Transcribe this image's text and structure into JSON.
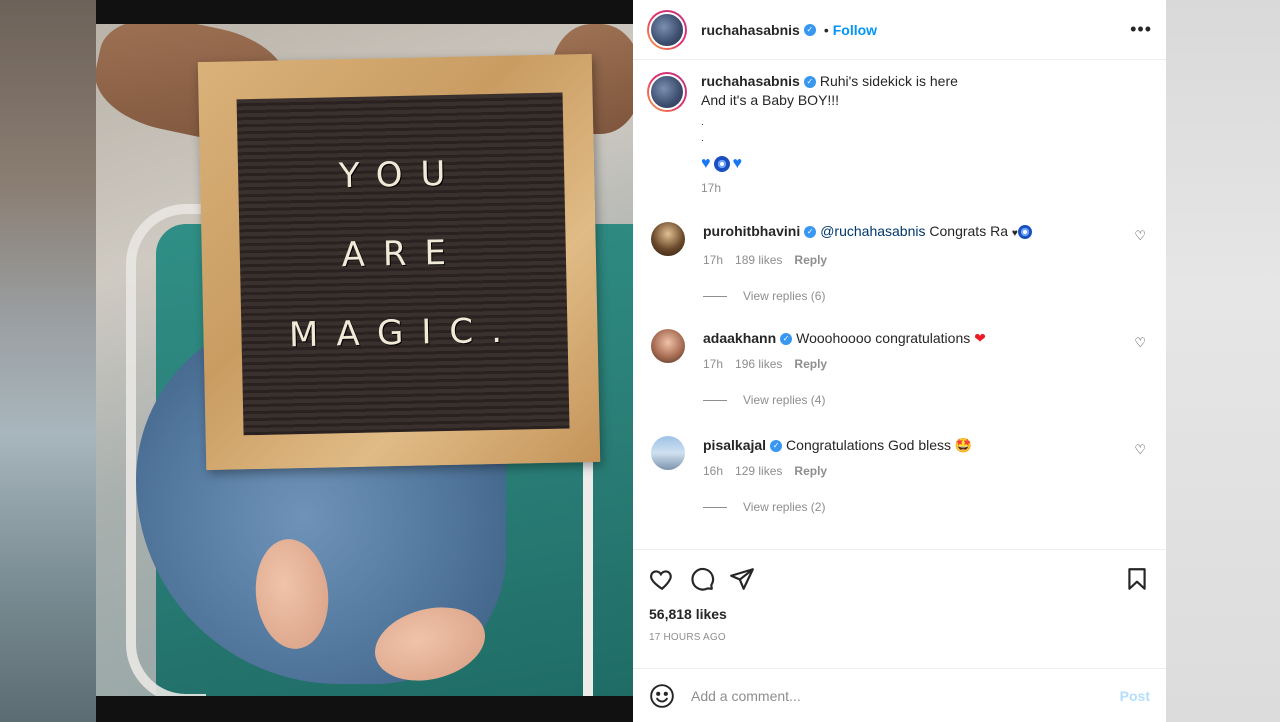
{
  "post": {
    "author": "ruchahasabnis",
    "follow_label": "Follow",
    "dot": "•",
    "more_label": "•••",
    "board_lines": [
      "YOU",
      "ARE",
      "MAGIC."
    ]
  },
  "caption": {
    "author": "ruchahasabnis",
    "line1": "Ruhi's sidekick is here",
    "line2": "And it's a Baby BOY!!!",
    "dot1": ".",
    "dot2": ".",
    "time": "17h"
  },
  "comments": [
    {
      "user": "purohitbhavini",
      "mention": "@ruchahasabnis",
      "text": " Congrats Ra ",
      "heart": "♥",
      "time": "17h",
      "likes": "189 likes",
      "reply": "Reply",
      "view_replies": "View replies (6)"
    },
    {
      "user": "adaakhann",
      "text": "Wooohoooo congratulations ",
      "heart": "❤",
      "time": "17h",
      "likes": "196 likes",
      "reply": "Reply",
      "view_replies": "View replies (4)"
    },
    {
      "user": "pisalkajal",
      "text": "Congratulations God bless ",
      "emoji": "🤩",
      "time": "16h",
      "likes": "129 likes",
      "reply": "Reply",
      "view_replies": "View replies (2)"
    }
  ],
  "stats": {
    "likes": "56,818 likes",
    "ago": "17 HOURS AGO"
  },
  "add_comment": {
    "placeholder": "Add a comment...",
    "post_label": "Post"
  },
  "icons": {
    "like": "heart-icon",
    "comment": "comment-icon",
    "share": "share-icon",
    "save": "bookmark-icon",
    "emoji": "smiley-icon"
  },
  "colors": {
    "accent": "#0095f6",
    "verified": "#3897f0",
    "muted": "#8e8e8e"
  }
}
